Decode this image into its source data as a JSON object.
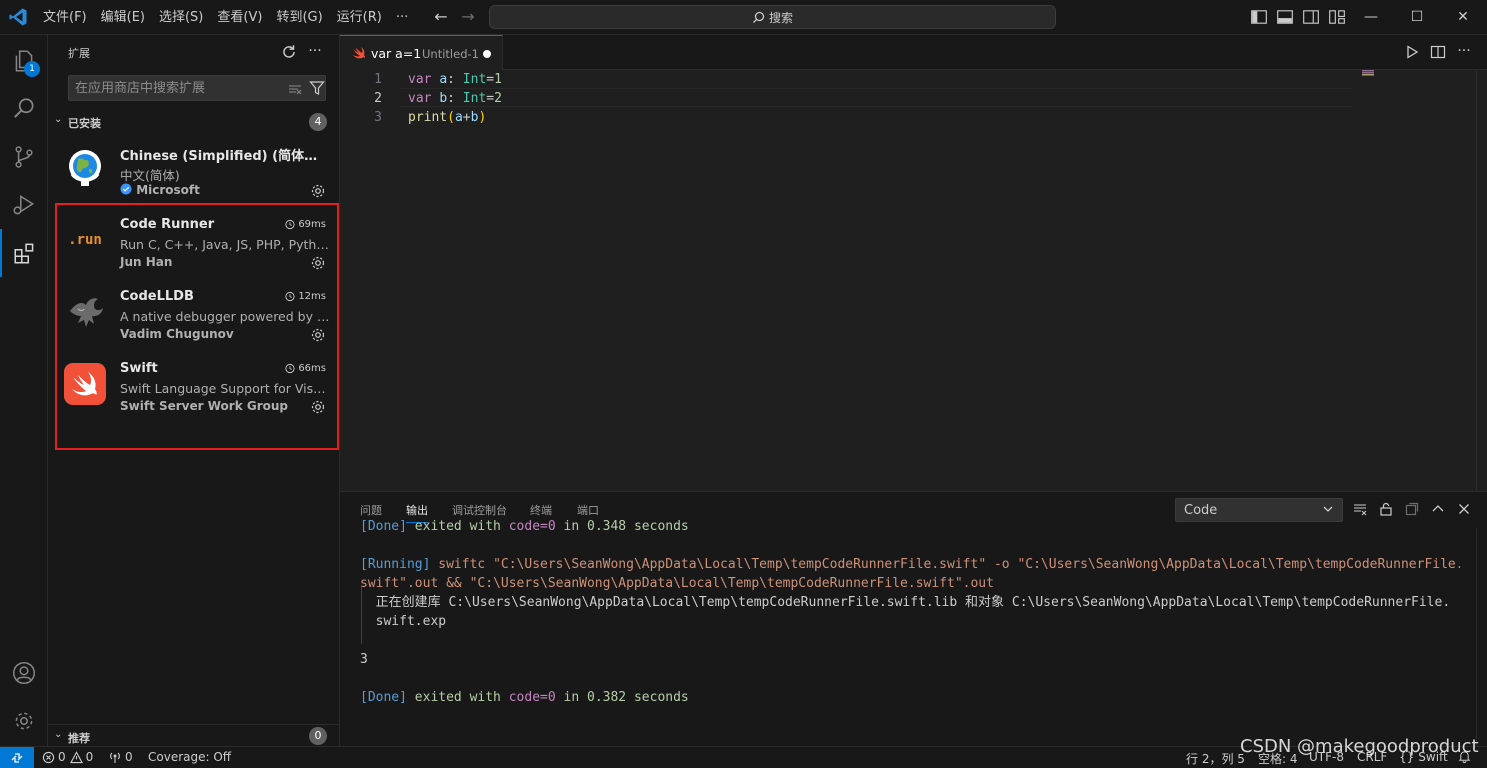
{
  "menu": {
    "items": [
      "文件(F)",
      "编辑(E)",
      "选择(S)",
      "查看(V)",
      "转到(G)",
      "运行(R)",
      "···"
    ],
    "search_label": "搜索"
  },
  "activity": {
    "explorer_badge": "1"
  },
  "sidebar": {
    "title": "扩展",
    "search_placeholder": "在应用商店中搜索扩展",
    "installed_label": "已安装",
    "installed_count": "4",
    "extensions": [
      {
        "name": "Chinese (Simplified) (简体中文) Language Pack for Visual Studio Code",
        "desc": "中文(简体)",
        "publisher": "Microsoft",
        "verified": true,
        "time": ""
      },
      {
        "name": "Code Runner",
        "desc": "Run C, C++, Java, JS, PHP, Python, Perl, Ruby, Go, Lua, Groovy, PowerShell, CMD, BASH...",
        "publisher": "Jun Han",
        "icon_text": ".run",
        "time": "69ms"
      },
      {
        "name": "CodeLLDB",
        "desc": "A native debugger powered by LLDB. Debug C++, Rust and other compiled languages.",
        "publisher": "Vadim Chugunov",
        "time": "12ms"
      },
      {
        "name": "Swift",
        "desc": "Swift Language Support for Visual Studio Code.",
        "publisher": "Swift Server Work Group",
        "time": "66ms"
      }
    ],
    "recommended_label": "推荐",
    "recommended_count": "0"
  },
  "editor": {
    "tab": {
      "name": "var a=1",
      "desc": "Untitled-1"
    },
    "line_numbers": [
      "1",
      "2",
      "3"
    ]
  },
  "panel": {
    "tabs": [
      "问题",
      "输出",
      "调试控制台",
      "终端",
      "端口"
    ],
    "active_tab": "输出",
    "output_channel": "Code",
    "lines": {
      "l0a": "[Done]",
      "l0b": " exited with ",
      "l0c": "code=0",
      "l0d": " in ",
      "l0e": "0.348",
      "l0f": " seconds",
      "l1a": "[Running]",
      "l1b": " swiftc \"C:\\Users\\SeanWong\\AppData\\Local\\Temp\\tempCodeRunnerFile.swift\" -o \"C:\\Users\\SeanWong\\AppData\\Local\\Temp\\tempCodeRunnerFile.",
      "l2": "swift\".out && \"C:\\Users\\SeanWong\\AppData\\Local\\Temp\\tempCodeRunnerFile.swift\".out",
      "l3": "  正在创建库 C:\\Users\\SeanWong\\AppData\\Local\\Temp\\tempCodeRunnerFile.swift.lib 和对象 C:\\Users\\SeanWong\\AppData\\Local\\Temp\\tempCodeRunnerFile.",
      "l4": "  swift.exp",
      "l5": "3",
      "l6a": "[Done]",
      "l6b": " exited with ",
      "l6c": "code=0",
      "l6d": " in ",
      "l6e": "0.382",
      "l6f": " seconds"
    }
  },
  "status": {
    "errors": "0",
    "warnings": "0",
    "ports": "0",
    "coverage": "Coverage: Off",
    "position": "行 2，列 5",
    "spaces": "空格: 4",
    "encoding": "UTF-8",
    "eol": "CRLF",
    "language": "Swift"
  },
  "watermark": "CSDN @makegoodproduct",
  "colors": {
    "accent": "#0078d4",
    "highlight_box": "#e51e1e",
    "swift": "#f05138",
    "code_runner": "#e8902a"
  }
}
